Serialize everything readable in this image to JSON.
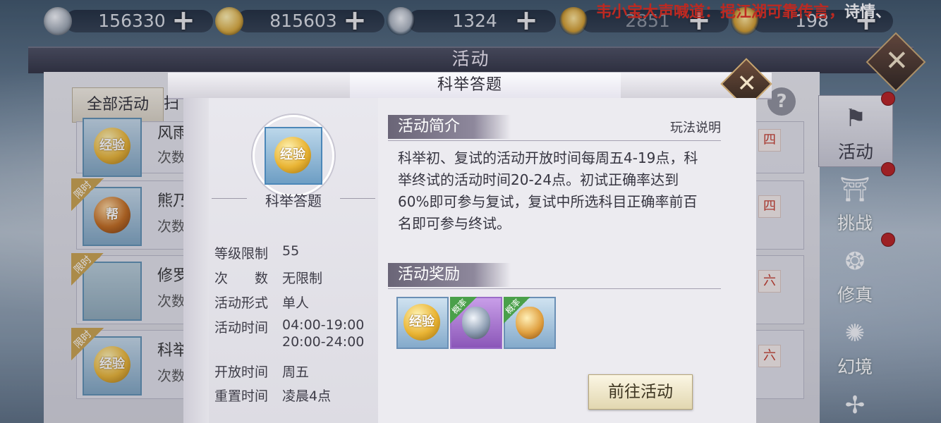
{
  "resources": [
    {
      "icon": "silver-coin-icon",
      "value": "156330"
    },
    {
      "icon": "gold-coin-icon",
      "value": "815603"
    },
    {
      "icon": "silver-ingot-icon",
      "value": "1324"
    },
    {
      "icon": "gold-ingot-icon",
      "value": "2851"
    },
    {
      "icon": "yuanbao-icon",
      "value": "198"
    }
  ],
  "marquee": {
    "speaker": "韦小宝大声喊道：",
    "message": "挹江湖可靠传言，",
    "extra": "诗情、"
  },
  "window": {
    "title": "活动",
    "tab_all": "全部活动",
    "tab_partial": "扫"
  },
  "rows": [
    {
      "title": "风雨",
      "count": "次数",
      "day": "四",
      "icon": "exp-coin-icon",
      "coin_label": "经验",
      "limited": ""
    },
    {
      "title": "熊乃",
      "count": "次数",
      "day": "四",
      "icon": "guild-medal-icon",
      "coin_label": "帮",
      "limited": "限时"
    },
    {
      "title": "修罗",
      "count": "次数",
      "day": "六",
      "icon": "armor-icon",
      "coin_label": "",
      "limited": "限时"
    },
    {
      "title": "科举",
      "count": "次数",
      "day": "六",
      "icon": "exp-coin-icon",
      "coin_label": "经验",
      "limited": "限时"
    }
  ],
  "side_nav": [
    {
      "label": "活动",
      "icon": "banner-icon",
      "active": true
    },
    {
      "label": "挑战",
      "icon": "gate-icon",
      "active": false
    },
    {
      "label": "修真",
      "icon": "swirl-icon",
      "active": false
    },
    {
      "label": "幻境",
      "icon": "spiral-icon",
      "active": false
    }
  ],
  "modal": {
    "title": "科举答题",
    "activity_name": "科举答题",
    "badge_label": "经验",
    "info": [
      {
        "key": "等级限制",
        "value": "55"
      },
      {
        "key": "次　　数",
        "value": "无限制"
      },
      {
        "key": "活动形式",
        "value": "单人"
      },
      {
        "key": "活动时间",
        "value": "04:00-19:00"
      },
      {
        "key": "",
        "value": "20:00-24:00"
      },
      {
        "key": "开放时间",
        "value": "周五"
      },
      {
        "key": "重置时间",
        "value": "凌晨4点"
      }
    ],
    "intro_header": "活动简介",
    "rules_link": "玩法说明",
    "description": "科举初、复试的活动开放时间每周五4-19点，科举终试的活动时间20-24点。初试正确率达到60%即可参与复试，复试中所选科目正确率前百名即可参与终试。",
    "reward_header": "活动奖励",
    "rewards": [
      {
        "icon": "exp-coin-icon",
        "label": "经验",
        "tag": ""
      },
      {
        "icon": "silver-gem-icon",
        "label": "",
        "tag": "概率"
      },
      {
        "icon": "amber-crystal-icon",
        "label": "",
        "tag": "概率"
      }
    ],
    "go_button": "前往活动"
  }
}
